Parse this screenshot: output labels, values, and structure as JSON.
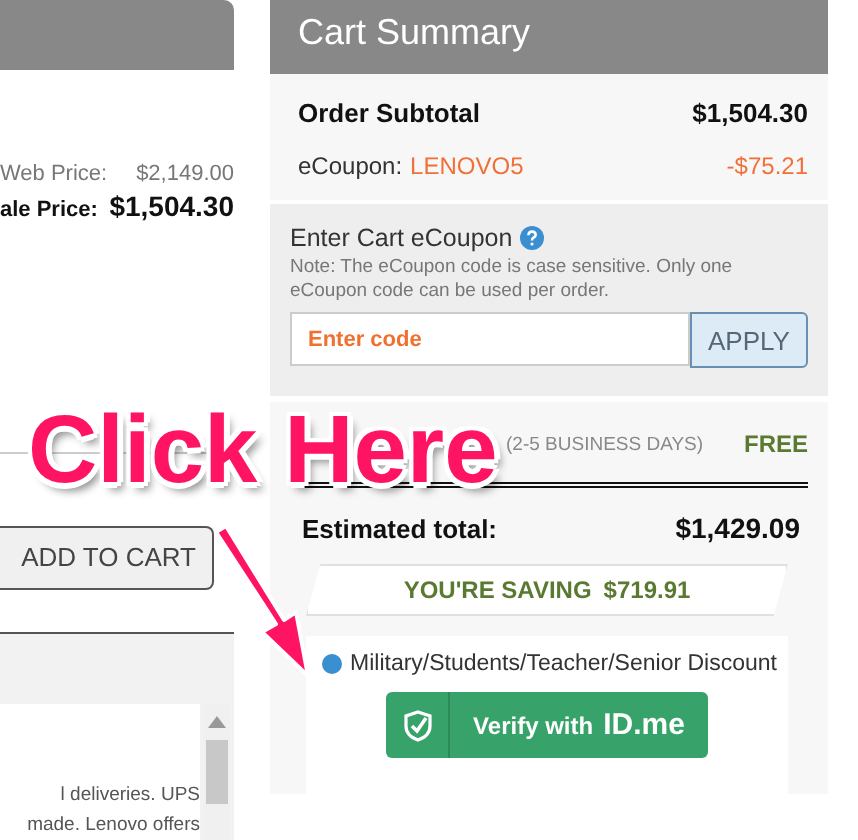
{
  "left_panel": {
    "price_rows": [
      {
        "label": "Web Price:",
        "value": "$2,149.00",
        "emphasis": false
      },
      {
        "label": "ale Price:",
        "value": "$1,504.30",
        "emphasis": true
      }
    ],
    "add_to_cart": "ADD TO CART",
    "notice_lines": [
      "l deliveries. UPS",
      "made. Lenovo offers"
    ]
  },
  "cart_summary": {
    "title": "Cart Summary",
    "subtotal": {
      "label": "Order Subtotal",
      "value": "$1,504.30"
    },
    "ecoupon": {
      "label": "eCoupon:",
      "code": "LENOVO5",
      "value": "-$75.21"
    },
    "coupon_entry": {
      "title": "Enter Cart eCoupon",
      "note": "Note: The eCoupon code is case sensitive. Only one eCoupon code can be used per order.",
      "placeholder": "Enter code",
      "button": "APPLY"
    },
    "shipping": {
      "label": "(2-5 BUSINESS DAYS)",
      "value": "FREE"
    },
    "estimated_total": {
      "label": "Estimated total:",
      "value": "$1,429.09"
    },
    "saving": {
      "label": "YOU'RE SAVING",
      "value": "$719.91"
    },
    "discount": {
      "label": "Military/Students/Teacher/Senior Discount",
      "selected": true
    },
    "verify_button": {
      "label": "Verify with",
      "brand": "ID.me"
    }
  },
  "annotation": {
    "text": "Click Here"
  }
}
